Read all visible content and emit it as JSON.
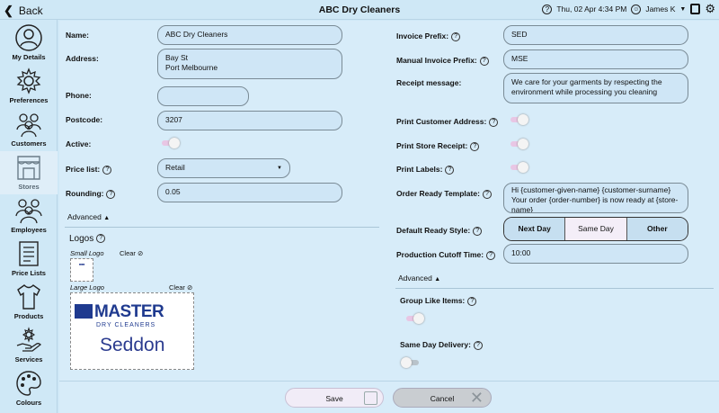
{
  "header": {
    "back_label": "Back",
    "title": "ABC Dry Cleaners",
    "datetime": "Thu, 02 Apr 4:34 PM",
    "user": "James K"
  },
  "sidebar": {
    "items": [
      {
        "label": "My Details",
        "icon": "person-icon"
      },
      {
        "label": "Preferences",
        "icon": "gear-icon"
      },
      {
        "label": "Customers",
        "icon": "customers-icon"
      },
      {
        "label": "Stores",
        "icon": "store-icon"
      },
      {
        "label": "Employees",
        "icon": "employees-icon"
      },
      {
        "label": "Price Lists",
        "icon": "list-icon"
      },
      {
        "label": "Products",
        "icon": "shirt-icon"
      },
      {
        "label": "Services",
        "icon": "services-icon"
      },
      {
        "label": "Colours",
        "icon": "palette-icon"
      }
    ]
  },
  "left": {
    "name_label": "Name:",
    "name_value": "ABC Dry Cleaners",
    "address_label": "Address:",
    "address_line1": "Bay St",
    "address_line2": "Port Melbourne",
    "phone_label": "Phone:",
    "phone_value": "",
    "postcode_label": "Postcode:",
    "postcode_value": "3207",
    "active_label": "Active:",
    "pricelist_label": "Price list:",
    "pricelist_value": "Retail",
    "rounding_label": "Rounding:",
    "rounding_value": "0.05",
    "advanced_label": "Advanced",
    "logos_label": "Logos",
    "small_logo_label": "Small Logo",
    "large_logo_label": "Large Logo",
    "clear_label": "Clear",
    "logo_text_top": "MASTER",
    "logo_text_mid": "DRY CLEANERS",
    "logo_text_bottom": "Seddon"
  },
  "right": {
    "invoice_prefix_label": "Invoice Prefix:",
    "invoice_prefix_value": "SED",
    "manual_prefix_label": "Manual Invoice Prefix:",
    "manual_prefix_value": "MSE",
    "receipt_msg_label": "Receipt message:",
    "receipt_msg_line1": "We care for your garments by respecting the",
    "receipt_msg_line2": "environment while processing you cleaning",
    "print_address_label": "Print Customer Address:",
    "print_receipt_label": "Print Store Receipt:",
    "print_labels_label": "Print Labels:",
    "order_ready_label": "Order Ready Template:",
    "order_ready_line1": "Hi {customer-given-name} {customer-surname}",
    "order_ready_line2": "Your order {order-number} is now ready at {store-",
    "order_ready_line3": "name}",
    "default_ready_label": "Default Ready Style:",
    "ready_options": [
      "Next Day",
      "Same Day",
      "Other"
    ],
    "cutoff_label": "Production Cutoff Time:",
    "cutoff_value": "10:00",
    "advanced_label": "Advanced",
    "group_like_label": "Group Like Items:",
    "same_day_label": "Same Day Delivery:"
  },
  "footer": {
    "save_label": "Save",
    "cancel_label": "Cancel"
  }
}
